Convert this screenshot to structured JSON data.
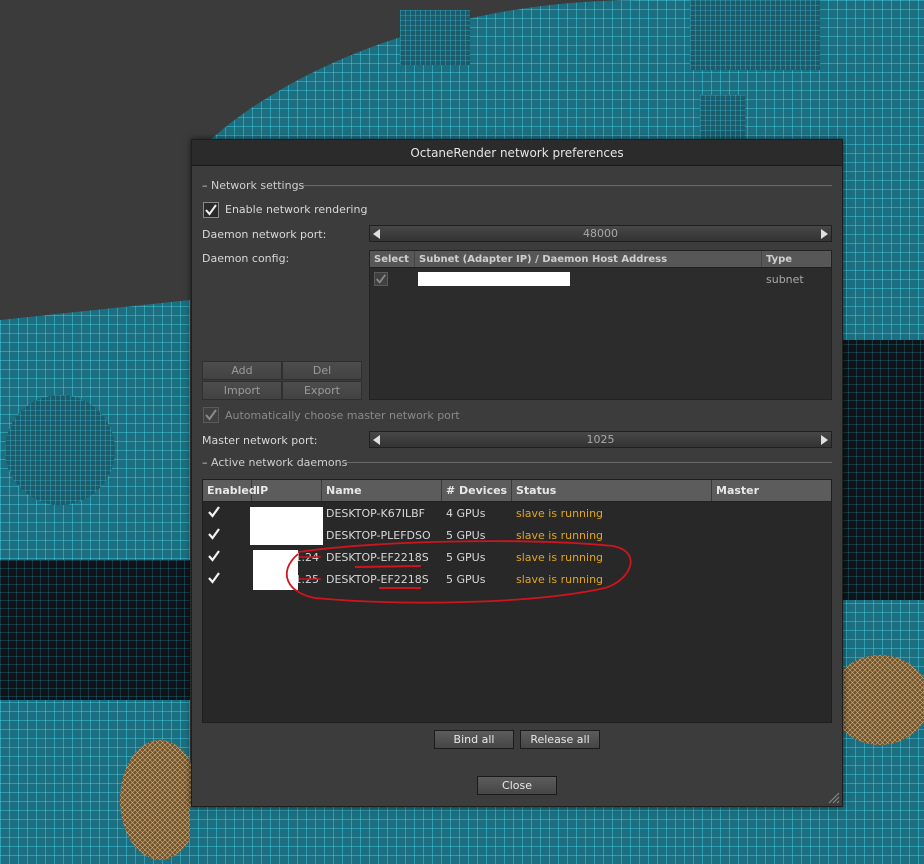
{
  "window": {
    "title": "OctaneRender network preferences"
  },
  "network_settings": {
    "group_title": "Network settings",
    "enable_label": "Enable network rendering",
    "enable_checked": true,
    "daemon_port_label": "Daemon network port:",
    "daemon_port_value": "48000",
    "daemon_config_label": "Daemon config:",
    "config_table": {
      "columns": [
        "Select",
        "Subnet (Adapter IP) / Daemon Host Address",
        "Type"
      ],
      "rows": [
        {
          "selected": true,
          "address": "",
          "type": "subnet"
        }
      ]
    },
    "buttons": {
      "add": "Add",
      "del": "Del",
      "import": "Import",
      "export": "Export"
    },
    "auto_master_label": "Automatically choose master network port",
    "auto_master_checked": true,
    "master_port_label": "Master network port:",
    "master_port_value": "1025"
  },
  "active_daemons": {
    "group_title": "Active network daemons",
    "columns": [
      "Enabled",
      "IP Address",
      "Name",
      "# Devices",
      "Status",
      "Master"
    ],
    "rows": [
      {
        "enabled": true,
        "ip": "",
        "name": "DESKTOP-K67ILBF",
        "devices": "4 GPUs",
        "status": "slave is running",
        "master": ""
      },
      {
        "enabled": true,
        "ip": "",
        "name": "DESKTOP-PLEFDSO",
        "devices": "5 GPUs",
        "status": "slave is running",
        "master": ""
      },
      {
        "enabled": true,
        "ip": "1.24",
        "name": "DESKTOP-EF2218S",
        "devices": "5 GPUs",
        "status": "slave is running",
        "master": ""
      },
      {
        "enabled": true,
        "ip": "1.25",
        "name": "DESKTOP-EF2218S",
        "devices": "5 GPUs",
        "status": "slave is running",
        "master": ""
      }
    ],
    "bind_all": "Bind all",
    "release_all": "Release all"
  },
  "close_label": "Close",
  "colors": {
    "wireframe_cyan": "#35d6f2",
    "wireframe_orange": "#c8a060",
    "status_orange": "#e2a51d",
    "annotation_red": "#d0141e"
  }
}
